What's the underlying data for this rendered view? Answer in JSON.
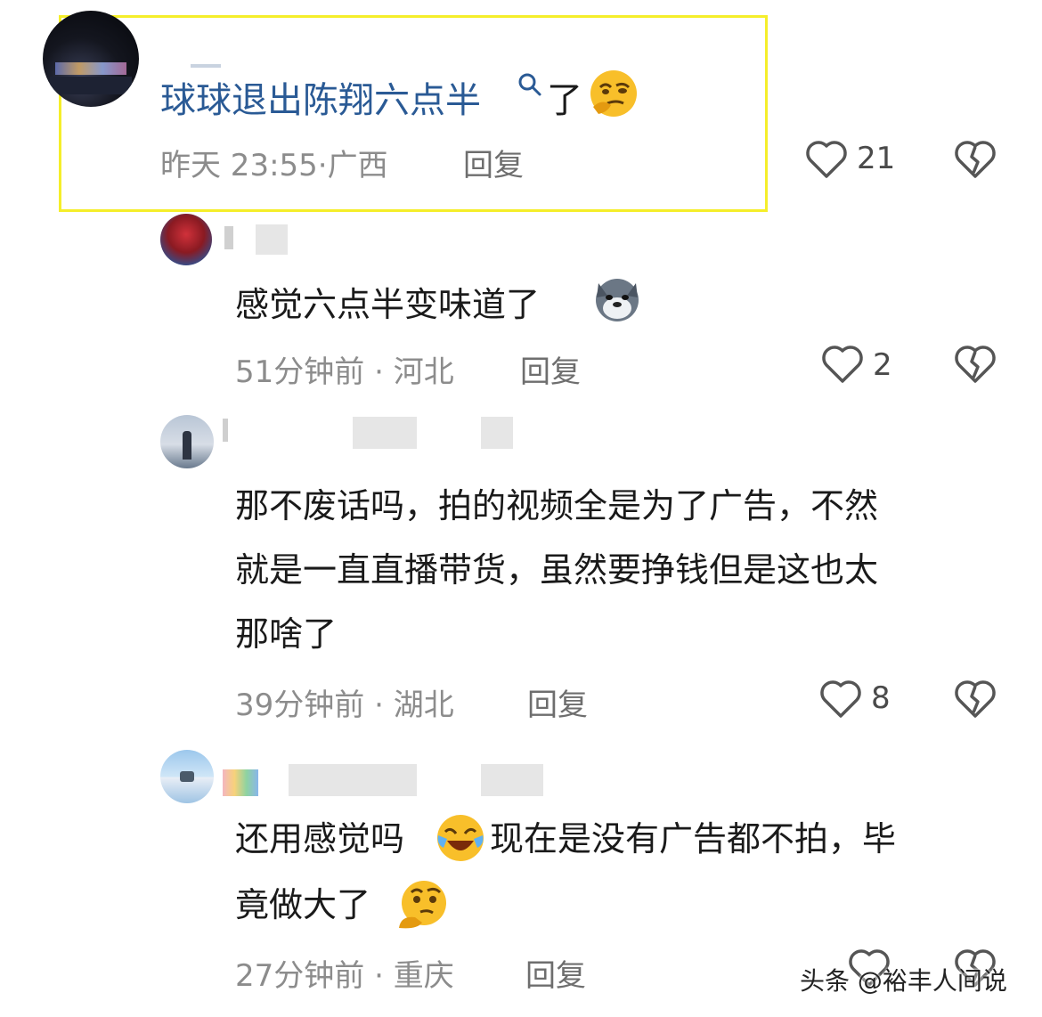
{
  "comments": [
    {
      "text_prefix": "球球退出陈翔六点半",
      "text_suffix": "了",
      "emoji": "thinking-face",
      "time": "昨天 23:55",
      "location": "广西",
      "reply_label": "回复",
      "likes": "21"
    },
    {
      "text": "感觉六点半变味道了",
      "emoji": "husky-dog-face",
      "time": "51分钟前",
      "location": "河北",
      "reply_label": "回复",
      "likes": "2"
    },
    {
      "lines": [
        "那不废话吗，拍的视频全是为了广告，不然",
        "就是一直直播带货，虽然要挣钱但是这也太",
        "那啥了"
      ],
      "time": "39分钟前",
      "location": "湖北",
      "reply_label": "回复",
      "likes": "8"
    },
    {
      "line1_prefix": "还用感觉吗",
      "line1_suffix": "现在是没有广告都不拍，毕",
      "line2": "竟做大了",
      "emojis": [
        "laughing-crying-face",
        "thinking-face"
      ],
      "time": "27分钟前",
      "location": "重庆",
      "reply_label": "回复"
    }
  ],
  "meta_separator": "·",
  "watermark": "头条 @裕丰人间说",
  "colors": {
    "highlight_border": "#f5ee2a",
    "link_text": "#2a5a95",
    "meta_text": "#8c8c8c"
  },
  "icons": [
    "search-icon",
    "heart-icon",
    "broken-heart-icon"
  ]
}
